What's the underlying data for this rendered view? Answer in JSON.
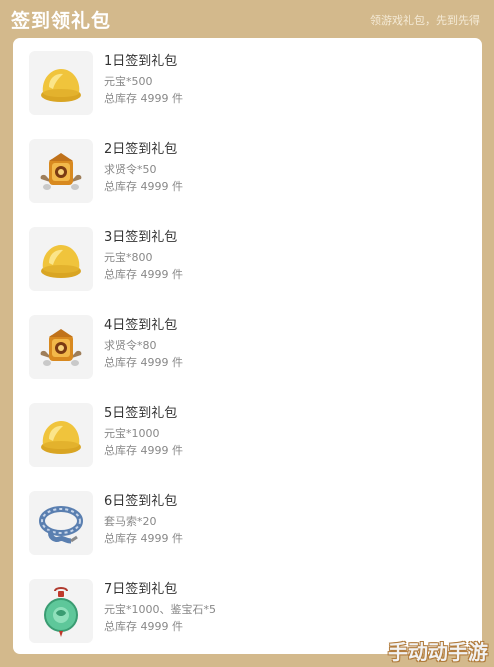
{
  "header": {
    "title": "签到领礼包",
    "subtitle": "领游戏礼包，先到先得"
  },
  "gifts": [
    {
      "name": "1日签到礼包",
      "reward": "元宝*500",
      "stock": "总库存 4999 件",
      "icon": "gold-ingot-icon"
    },
    {
      "name": "2日签到礼包",
      "reward": "求贤令*50",
      "stock": "总库存 4999 件",
      "icon": "recruit-token-icon"
    },
    {
      "name": "3日签到礼包",
      "reward": "元宝*800",
      "stock": "总库存 4999 件",
      "icon": "gold-ingot-icon"
    },
    {
      "name": "4日签到礼包",
      "reward": "求贤令*80",
      "stock": "总库存 4999 件",
      "icon": "recruit-token-icon"
    },
    {
      "name": "5日签到礼包",
      "reward": "元宝*1000",
      "stock": "总库存 4999 件",
      "icon": "gold-ingot-icon"
    },
    {
      "name": "6日签到礼包",
      "reward": "套马索*20",
      "stock": "总库存 4999 件",
      "icon": "lasso-icon"
    },
    {
      "name": "7日签到礼包",
      "reward": "元宝*1000、鉴宝石*5",
      "stock": "总库存 4999 件",
      "icon": "jade-pendant-icon"
    }
  ],
  "watermark": "手动动手游"
}
